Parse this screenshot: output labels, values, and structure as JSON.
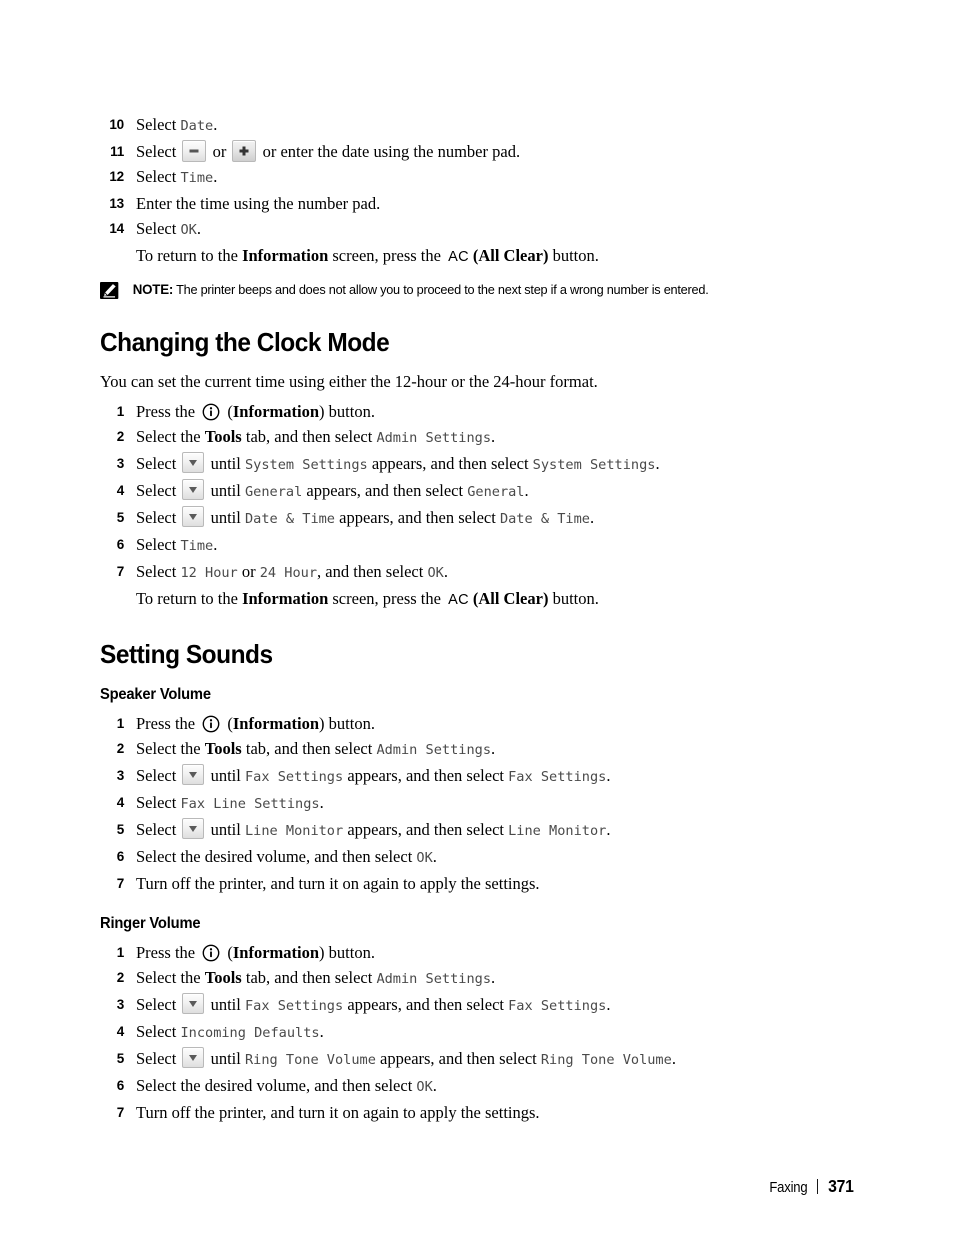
{
  "document": {
    "footer": {
      "section": "Faxing",
      "page_number": "371"
    }
  },
  "date_time_steps": {
    "s10": {
      "num": "10",
      "pre": "Select ",
      "code": "Date",
      "post": "."
    },
    "s11": {
      "num": "11",
      "pre": "Select ",
      "mid": " or ",
      "post": " or enter the date using the number pad."
    },
    "s12": {
      "num": "12",
      "pre": "Select ",
      "code": "Time",
      "post": "."
    },
    "s13": {
      "num": "13",
      "text": "Enter the time using the number pad."
    },
    "s14": {
      "num": "14",
      "pre": "Select ",
      "code": "OK",
      "post": "."
    },
    "return_note": {
      "pre": "To return to the ",
      "bold": "Information",
      "mid": " screen, press the ",
      "ac": "AC",
      "bold2": "(All Clear)",
      "post": " button."
    }
  },
  "note": {
    "label": "NOTE:",
    "text": " The printer beeps and does not allow you to proceed to the next step if a wrong number is entered.",
    "icon": "pencil-note-icon"
  },
  "clock_mode": {
    "heading": "Changing the Clock Mode",
    "intro": "You can set the current time using either the 12-hour or the 24-hour format.",
    "steps": [
      {
        "num": "1",
        "pre": "Press the ",
        "post": " (",
        "bold": "Information",
        "tail": ") button."
      },
      {
        "num": "2",
        "pre": "Select the ",
        "bold": "Tools",
        "mid": " tab, and then select ",
        "code": "Admin  Settings",
        "post": "."
      },
      {
        "num": "3",
        "pre": "Select ",
        "mid": " until ",
        "code1": "System  Settings",
        "mid2": " appears, and then select ",
        "code2": "System  Settings",
        "post": "."
      },
      {
        "num": "4",
        "pre": "Select ",
        "mid": " until ",
        "code1": "General",
        "mid2": " appears, and then select ",
        "code2": "General",
        "post": "."
      },
      {
        "num": "5",
        "pre": "Select ",
        "mid": " until ",
        "code1": "Date  &  Time",
        "mid2": " appears, and then select ",
        "code2": "Date  &  Time",
        "post": "."
      },
      {
        "num": "6",
        "pre": "Select ",
        "code1": "Time",
        "post": "."
      },
      {
        "num": "7",
        "pre": "Select ",
        "code1": "12  Hour",
        "mid2": " or ",
        "code2": "24  Hour",
        "mid3": ", and then select ",
        "code3": "OK",
        "post": "."
      }
    ],
    "return_note": {
      "pre": "To return to the ",
      "bold": "Information",
      "mid": " screen, press the ",
      "ac": "AC",
      "bold2": "(All Clear)",
      "post": " button."
    }
  },
  "setting_sounds": {
    "heading": "Setting Sounds",
    "speaker_volume": {
      "heading": "Speaker Volume",
      "steps": [
        {
          "num": "1",
          "pre": "Press the ",
          "post": " (",
          "bold": "Information",
          "tail": ") button."
        },
        {
          "num": "2",
          "pre": "Select the ",
          "bold": "Tools",
          "mid": " tab, and then select ",
          "code": "Admin  Settings",
          "post": "."
        },
        {
          "num": "3",
          "pre": "Select ",
          "mid": " until ",
          "code1": "Fax  Settings",
          "mid2": " appears, and then select ",
          "code2": "Fax  Settings",
          "post": "."
        },
        {
          "num": "4",
          "pre": "Select ",
          "code1": "Fax  Line  Settings",
          "post": "."
        },
        {
          "num": "5",
          "pre": "Select ",
          "mid": " until ",
          "code1": "Line  Monitor",
          "mid2": " appears, and then select ",
          "code2": "Line  Monitor",
          "post": "."
        },
        {
          "num": "6",
          "pre": "Select the desired volume, and then select ",
          "code1": "OK",
          "post": "."
        },
        {
          "num": "7",
          "text": "Turn off the printer, and turn it on again to apply the settings."
        }
      ]
    },
    "ringer_volume": {
      "heading": "Ringer Volume",
      "steps": [
        {
          "num": "1",
          "pre": "Press the ",
          "post": " (",
          "bold": "Information",
          "tail": ") button."
        },
        {
          "num": "2",
          "pre": "Select the ",
          "bold": "Tools",
          "mid": " tab, and then select ",
          "code": "Admin  Settings",
          "post": "."
        },
        {
          "num": "3",
          "pre": "Select ",
          "mid": " until ",
          "code1": "Fax  Settings",
          "mid2": " appears, and then select ",
          "code2": "Fax  Settings",
          "post": "."
        },
        {
          "num": "4",
          "pre": "Select ",
          "code1": "Incoming  Defaults",
          "post": "."
        },
        {
          "num": "5",
          "pre": "Select ",
          "mid": " until ",
          "code1": "Ring  Tone  Volume",
          "mid2": " appears, and then select ",
          "code2": "Ring  Tone  Volume",
          "post": "."
        },
        {
          "num": "6",
          "pre": "Select the desired volume, and then select ",
          "code1": "OK",
          "post": "."
        },
        {
          "num": "7",
          "text": "Turn off the printer, and turn it on again to apply the settings."
        }
      ]
    }
  },
  "icons": {
    "information": "information-icon",
    "minus_key": "minus-key-icon",
    "plus_key": "plus-key-icon",
    "down_arrow_key": "down-arrow-key-icon",
    "all_clear": "all-clear-icon"
  }
}
